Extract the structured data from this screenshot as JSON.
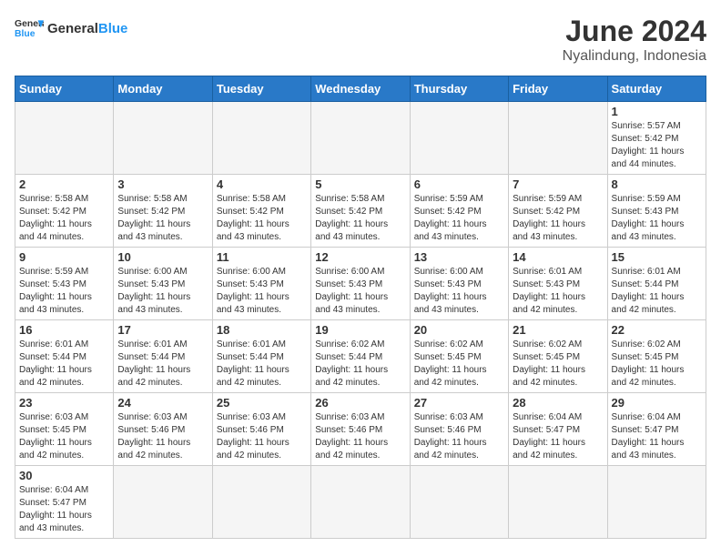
{
  "header": {
    "logo_general": "General",
    "logo_blue": "Blue",
    "month_year": "June 2024",
    "location": "Nyalindung, Indonesia"
  },
  "days_of_week": [
    "Sunday",
    "Monday",
    "Tuesday",
    "Wednesday",
    "Thursday",
    "Friday",
    "Saturday"
  ],
  "weeks": [
    [
      {
        "day": "",
        "info": ""
      },
      {
        "day": "",
        "info": ""
      },
      {
        "day": "",
        "info": ""
      },
      {
        "day": "",
        "info": ""
      },
      {
        "day": "",
        "info": ""
      },
      {
        "day": "",
        "info": ""
      },
      {
        "day": "1",
        "info": "Sunrise: 5:57 AM\nSunset: 5:42 PM\nDaylight: 11 hours\nand 44 minutes."
      }
    ],
    [
      {
        "day": "2",
        "info": "Sunrise: 5:58 AM\nSunset: 5:42 PM\nDaylight: 11 hours\nand 44 minutes."
      },
      {
        "day": "3",
        "info": "Sunrise: 5:58 AM\nSunset: 5:42 PM\nDaylight: 11 hours\nand 43 minutes."
      },
      {
        "day": "4",
        "info": "Sunrise: 5:58 AM\nSunset: 5:42 PM\nDaylight: 11 hours\nand 43 minutes."
      },
      {
        "day": "5",
        "info": "Sunrise: 5:58 AM\nSunset: 5:42 PM\nDaylight: 11 hours\nand 43 minutes."
      },
      {
        "day": "6",
        "info": "Sunrise: 5:59 AM\nSunset: 5:42 PM\nDaylight: 11 hours\nand 43 minutes."
      },
      {
        "day": "7",
        "info": "Sunrise: 5:59 AM\nSunset: 5:42 PM\nDaylight: 11 hours\nand 43 minutes."
      },
      {
        "day": "8",
        "info": "Sunrise: 5:59 AM\nSunset: 5:43 PM\nDaylight: 11 hours\nand 43 minutes."
      }
    ],
    [
      {
        "day": "9",
        "info": "Sunrise: 5:59 AM\nSunset: 5:43 PM\nDaylight: 11 hours\nand 43 minutes."
      },
      {
        "day": "10",
        "info": "Sunrise: 6:00 AM\nSunset: 5:43 PM\nDaylight: 11 hours\nand 43 minutes."
      },
      {
        "day": "11",
        "info": "Sunrise: 6:00 AM\nSunset: 5:43 PM\nDaylight: 11 hours\nand 43 minutes."
      },
      {
        "day": "12",
        "info": "Sunrise: 6:00 AM\nSunset: 5:43 PM\nDaylight: 11 hours\nand 43 minutes."
      },
      {
        "day": "13",
        "info": "Sunrise: 6:00 AM\nSunset: 5:43 PM\nDaylight: 11 hours\nand 43 minutes."
      },
      {
        "day": "14",
        "info": "Sunrise: 6:01 AM\nSunset: 5:43 PM\nDaylight: 11 hours\nand 42 minutes."
      },
      {
        "day": "15",
        "info": "Sunrise: 6:01 AM\nSunset: 5:44 PM\nDaylight: 11 hours\nand 42 minutes."
      }
    ],
    [
      {
        "day": "16",
        "info": "Sunrise: 6:01 AM\nSunset: 5:44 PM\nDaylight: 11 hours\nand 42 minutes."
      },
      {
        "day": "17",
        "info": "Sunrise: 6:01 AM\nSunset: 5:44 PM\nDaylight: 11 hours\nand 42 minutes."
      },
      {
        "day": "18",
        "info": "Sunrise: 6:01 AM\nSunset: 5:44 PM\nDaylight: 11 hours\nand 42 minutes."
      },
      {
        "day": "19",
        "info": "Sunrise: 6:02 AM\nSunset: 5:44 PM\nDaylight: 11 hours\nand 42 minutes."
      },
      {
        "day": "20",
        "info": "Sunrise: 6:02 AM\nSunset: 5:45 PM\nDaylight: 11 hours\nand 42 minutes."
      },
      {
        "day": "21",
        "info": "Sunrise: 6:02 AM\nSunset: 5:45 PM\nDaylight: 11 hours\nand 42 minutes."
      },
      {
        "day": "22",
        "info": "Sunrise: 6:02 AM\nSunset: 5:45 PM\nDaylight: 11 hours\nand 42 minutes."
      }
    ],
    [
      {
        "day": "23",
        "info": "Sunrise: 6:03 AM\nSunset: 5:45 PM\nDaylight: 11 hours\nand 42 minutes."
      },
      {
        "day": "24",
        "info": "Sunrise: 6:03 AM\nSunset: 5:46 PM\nDaylight: 11 hours\nand 42 minutes."
      },
      {
        "day": "25",
        "info": "Sunrise: 6:03 AM\nSunset: 5:46 PM\nDaylight: 11 hours\nand 42 minutes."
      },
      {
        "day": "26",
        "info": "Sunrise: 6:03 AM\nSunset: 5:46 PM\nDaylight: 11 hours\nand 42 minutes."
      },
      {
        "day": "27",
        "info": "Sunrise: 6:03 AM\nSunset: 5:46 PM\nDaylight: 11 hours\nand 42 minutes."
      },
      {
        "day": "28",
        "info": "Sunrise: 6:04 AM\nSunset: 5:47 PM\nDaylight: 11 hours\nand 42 minutes."
      },
      {
        "day": "29",
        "info": "Sunrise: 6:04 AM\nSunset: 5:47 PM\nDaylight: 11 hours\nand 43 minutes."
      }
    ],
    [
      {
        "day": "30",
        "info": "Sunrise: 6:04 AM\nSunset: 5:47 PM\nDaylight: 11 hours\nand 43 minutes."
      },
      {
        "day": "",
        "info": ""
      },
      {
        "day": "",
        "info": ""
      },
      {
        "day": "",
        "info": ""
      },
      {
        "day": "",
        "info": ""
      },
      {
        "day": "",
        "info": ""
      },
      {
        "day": "",
        "info": ""
      }
    ]
  ]
}
